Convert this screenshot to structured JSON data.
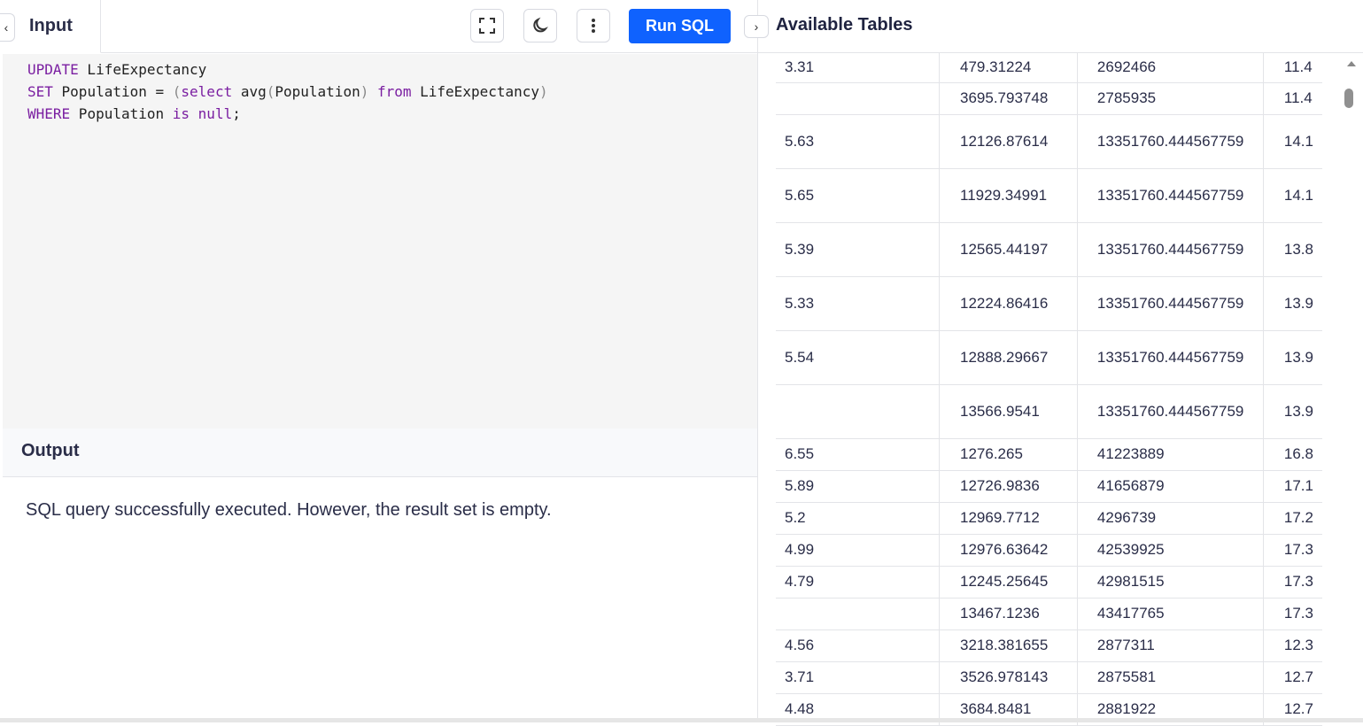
{
  "input": {
    "tab_label": "Input",
    "run_label": "Run SQL",
    "code_lines": [
      [
        {
          "t": "UPDATE",
          "c": "kw"
        },
        {
          "t": " LifeExpectancy",
          "c": "txt"
        }
      ],
      [
        {
          "t": "SET",
          "c": "kw"
        },
        {
          "t": " Population = ",
          "c": "txt"
        },
        {
          "t": "(",
          "c": "par"
        },
        {
          "t": "select",
          "c": "kw"
        },
        {
          "t": " avg",
          "c": "txt"
        },
        {
          "t": "(",
          "c": "par"
        },
        {
          "t": "Population",
          "c": "txt"
        },
        {
          "t": ")",
          "c": "par"
        },
        {
          "t": " ",
          "c": "txt"
        },
        {
          "t": "from",
          "c": "kw"
        },
        {
          "t": " LifeExpectancy",
          "c": "txt"
        },
        {
          "t": ")",
          "c": "par"
        }
      ],
      [
        {
          "t": "WHERE",
          "c": "kw"
        },
        {
          "t": " Population ",
          "c": "txt"
        },
        {
          "t": "is",
          "c": "kw"
        },
        {
          "t": " ",
          "c": "txt"
        },
        {
          "t": "null",
          "c": "kw"
        },
        {
          "t": ";",
          "c": "txt"
        }
      ]
    ]
  },
  "output": {
    "title": "Output",
    "message": "SQL query successfully executed. However, the result set is empty."
  },
  "tables_panel": {
    "title": "Available Tables",
    "rows": [
      {
        "h": "h36 first",
        "cells": [
          "3.31",
          "479.31224",
          "2692466",
          "11.4"
        ]
      },
      {
        "h": "h36",
        "cells": [
          "",
          "3695.793748",
          "2785935",
          "11.4"
        ]
      },
      {
        "h": "h61",
        "cells": [
          "5.63",
          "12126.87614",
          "13351760.444567759",
          "14.1"
        ]
      },
      {
        "h": "h61",
        "cells": [
          "5.65",
          "11929.34991",
          "13351760.444567759",
          "14.1"
        ]
      },
      {
        "h": "h61",
        "cells": [
          "5.39",
          "12565.44197",
          "13351760.444567759",
          "13.8"
        ]
      },
      {
        "h": "h61",
        "cells": [
          "5.33",
          "12224.86416",
          "13351760.444567759",
          "13.9"
        ]
      },
      {
        "h": "h61",
        "cells": [
          "5.54",
          "12888.29667",
          "13351760.444567759",
          "13.9"
        ]
      },
      {
        "h": "h61",
        "cells": [
          "",
          "13566.9541",
          "13351760.444567759",
          "13.9"
        ]
      },
      {
        "h": "h36",
        "cells": [
          "6.55",
          "1276.265",
          "41223889",
          "16.8"
        ]
      },
      {
        "h": "h36",
        "cells": [
          "5.89",
          "12726.9836",
          "41656879",
          "17.1"
        ]
      },
      {
        "h": "h36",
        "cells": [
          "5.2",
          "12969.7712",
          "4296739",
          "17.2"
        ]
      },
      {
        "h": "h36",
        "cells": [
          "4.99",
          "12976.63642",
          "42539925",
          "17.3"
        ]
      },
      {
        "h": "h36",
        "cells": [
          "4.79",
          "12245.25645",
          "42981515",
          "17.3"
        ]
      },
      {
        "h": "h36",
        "cells": [
          "",
          "13467.1236",
          "43417765",
          "17.3"
        ]
      },
      {
        "h": "h36",
        "cells": [
          "4.56",
          "3218.381655",
          "2877311",
          "12.3"
        ]
      },
      {
        "h": "h36",
        "cells": [
          "3.71",
          "3526.978143",
          "2875581",
          "12.7"
        ]
      },
      {
        "h": "h36",
        "cells": [
          "4.48",
          "3684.8481",
          "2881922",
          "12.7"
        ]
      }
    ]
  }
}
